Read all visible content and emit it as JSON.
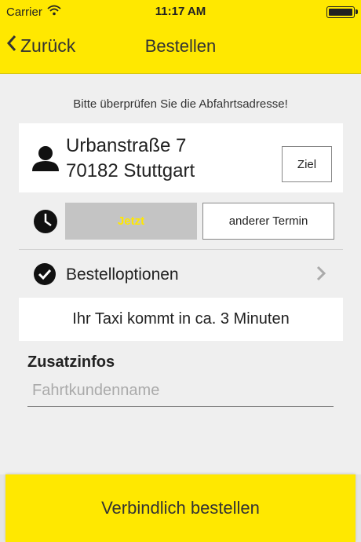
{
  "colors": {
    "accent": "#ffe800",
    "background": "#efefef",
    "disabled_button": "#c4c4c4"
  },
  "status_bar": {
    "carrier": "Carrier",
    "time": "11:17 AM",
    "icons": [
      "wifi-icon",
      "battery-icon"
    ]
  },
  "nav": {
    "back_label": "Zurück",
    "title": "Bestellen",
    "icons": [
      "chevron-left-icon"
    ]
  },
  "hint": "Bitte überprüfen Sie die Abfahrtsadresse!",
  "address": {
    "street": "Urbanstraße 7",
    "city": "70182 Stuttgart",
    "ziel_label": "Ziel",
    "icon": "person-icon"
  },
  "time_selection": {
    "icon": "clock-icon",
    "now_label": "Jetzt",
    "other_label": "anderer Termin"
  },
  "options": {
    "icon": "check-circle-icon",
    "label": "Bestelloptionen",
    "chevron": "chevron-right-icon"
  },
  "eta": "Ihr Taxi kommt in ca. 3 Minuten",
  "extra_info": {
    "title": "Zusatzinfos",
    "name_placeholder": "Fahrtkundenname",
    "name_value": ""
  },
  "order_button_label": "Verbindlich bestellen"
}
